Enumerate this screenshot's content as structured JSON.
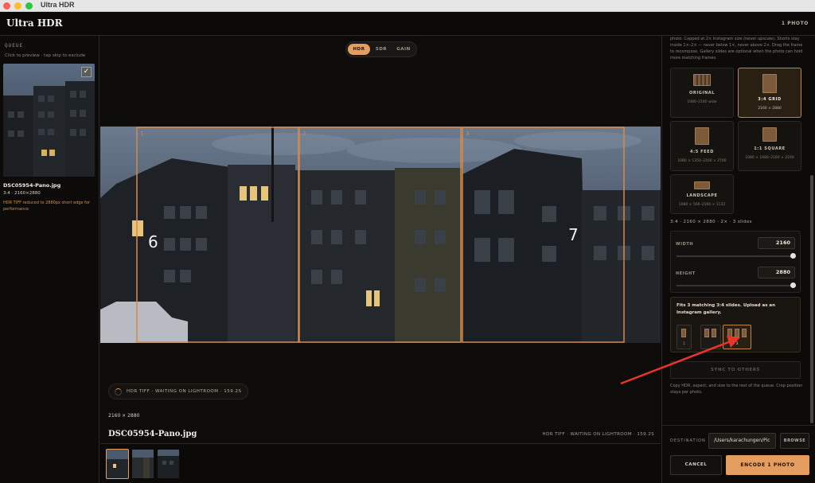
{
  "window": {
    "title": "Ultra HDR"
  },
  "header": {
    "app_title": "Ultra HDR",
    "photo_count": "1 PHOTO"
  },
  "queue": {
    "title": "QUEUE",
    "hint": "Click to preview · tap skip to exclude",
    "item": {
      "name": "DSC05954-Pano.jpg",
      "size": "3:4 · 2160×2880",
      "note": "HDR TIFF reduced to 2880px short edge for performance",
      "checked": true
    }
  },
  "viewer": {
    "modes": [
      "HDR",
      "SDR",
      "GAIN"
    ],
    "active_mode": "HDR",
    "slide_numbers": [
      "1",
      "2",
      "3"
    ],
    "building_numbers": [
      "6",
      "7"
    ],
    "status": "HDR TIFF · WAITING ON LIGHTROOM · 159.2S",
    "dimensions": "2160 × 2880",
    "filename": "DSC05954-Pano.jpg",
    "right_status": "HDR TIFF · WAITING ON LIGHTROOM · 159.2S"
  },
  "panel": {
    "intro": "photo. Capped at 2× Instagram size (never upscale). Shorts stay inside 1×–2× — never below 1×, never above 2×. Drag the frame to recompose. Gallery slides are optional when the photo can hold more matching frames.",
    "formats": [
      {
        "label": "ORIGINAL",
        "sub": "1080–2160 wide",
        "selected": false
      },
      {
        "label": "3:4 GRID",
        "sub": "2160 × 2880",
        "selected": true
      },
      {
        "label": "4:5 FEED",
        "sub": "1080 × 1350–2160 × 2700",
        "selected": false
      },
      {
        "label": "1:1 SQUARE",
        "sub": "1080 × 1080–2160 × 2160",
        "selected": false
      },
      {
        "label": "LANDSCAPE",
        "sub": "1080 × 566–2160 × 1132",
        "selected": false
      }
    ],
    "summary": "3:4 · 2160 × 2880 · 2× · 3 slides",
    "width_label": "WIDTH",
    "width_value": "2160",
    "height_label": "HEIGHT",
    "height_value": "2880",
    "gallery_text": "Fits 3 matching 3:4 slides. Upload as an Instagram gallery.",
    "gallery_options": [
      "1",
      "2",
      "3"
    ],
    "gallery_selected": "3",
    "sync_label": "SYNC TO OTHERS",
    "sync_note": "Copy HDR, aspect, and size to the rest of the queue. Crop position stays per photo.",
    "destination_label": "DESTINATION",
    "destination_value": "/Users/karachungen/Pic",
    "browse_label": "BROWSE",
    "cancel_label": "CANCEL",
    "encode_label": "ENCODE 1 PHOTO"
  },
  "colors": {
    "accent": "#e49d5e",
    "background": "#0d0c0b",
    "frame": "#d48a4a",
    "annotation": "#e8362a"
  }
}
